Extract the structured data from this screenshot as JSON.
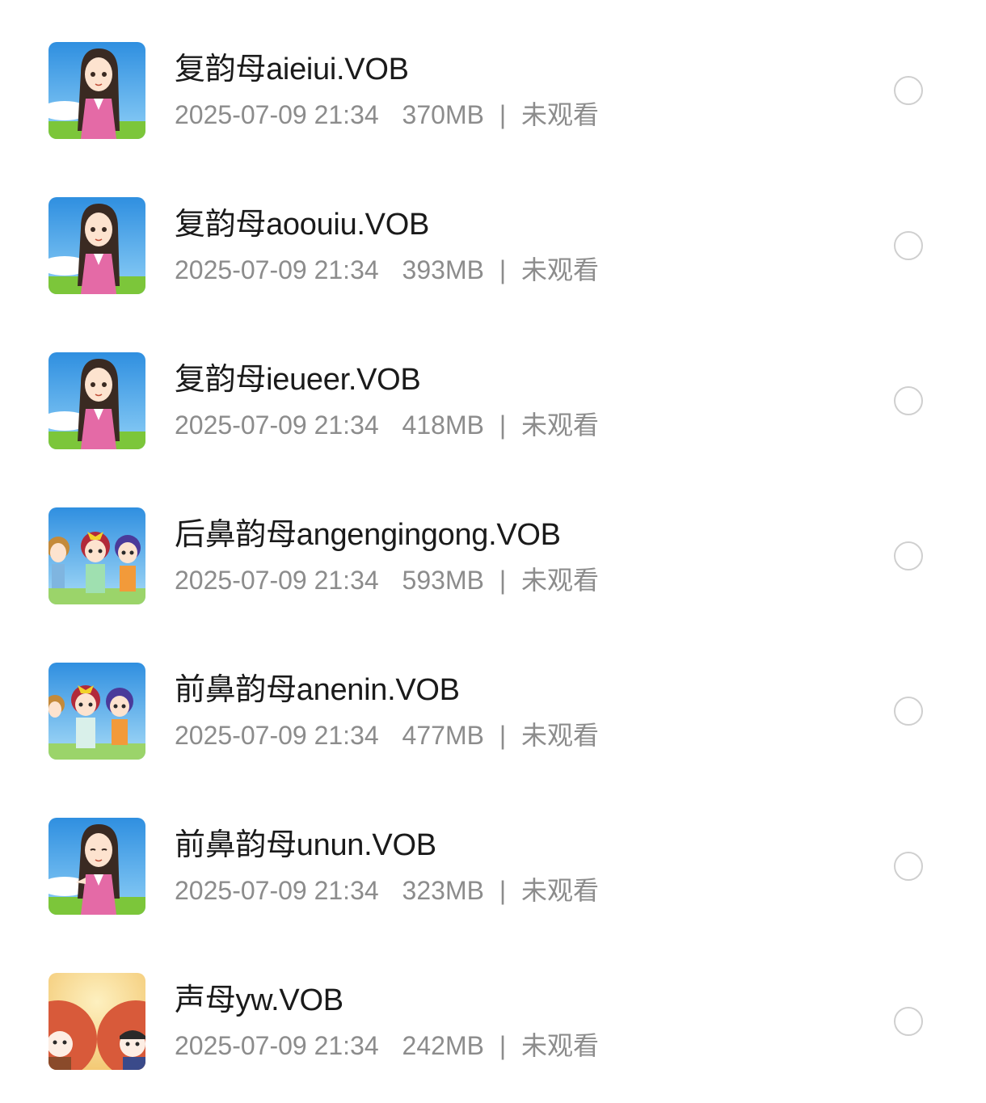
{
  "files": [
    {
      "name": "复韵母aieiui.VOB",
      "date": "2025-07-09 21:34",
      "size": "370MB",
      "status": "未观看",
      "thumbnail": "cartoon-girl-teacher"
    },
    {
      "name": "复韵母aoouiu.VOB",
      "date": "2025-07-09 21:34",
      "size": "393MB",
      "status": "未观看",
      "thumbnail": "cartoon-girl-teacher"
    },
    {
      "name": "复韵母ieueer.VOB",
      "date": "2025-07-09 21:34",
      "size": "418MB",
      "status": "未观看",
      "thumbnail": "cartoon-girl-teacher"
    },
    {
      "name": "后鼻韵母angengingong.VOB",
      "date": "2025-07-09 21:34",
      "size": "593MB",
      "status": "未观看",
      "thumbnail": "cartoon-three-girls"
    },
    {
      "name": "前鼻韵母anenin.VOB",
      "date": "2025-07-09 21:34",
      "size": "477MB",
      "status": "未观看",
      "thumbnail": "cartoon-three-girls"
    },
    {
      "name": "前鼻韵母unun.VOB",
      "date": "2025-07-09 21:34",
      "size": "323MB",
      "status": "未观看",
      "thumbnail": "cartoon-girl-teacher"
    },
    {
      "name": "声母yw.VOB",
      "date": "2025-07-09 21:34",
      "size": "242MB",
      "status": "未观看",
      "thumbnail": "cartoon-two-babies"
    }
  ],
  "separator": "|",
  "colors": {
    "title": "#1a1a1a",
    "meta": "#8c8c8c",
    "radio_border": "#cfcfcf",
    "sky": "#4aa8ea",
    "grass": "#7cc63a",
    "warm_bg": "#f6d88a"
  }
}
